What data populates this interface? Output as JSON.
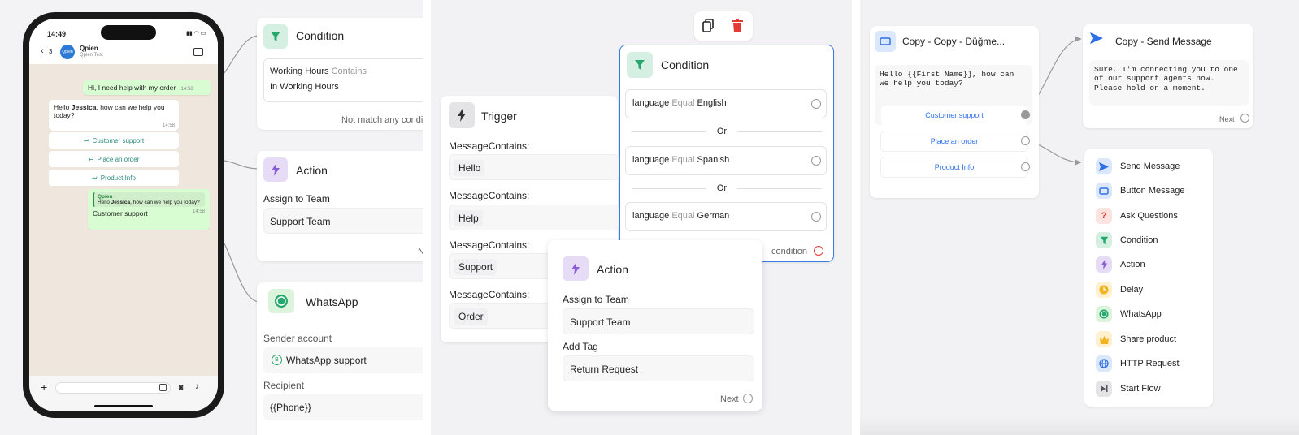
{
  "phone": {
    "time": "14:49",
    "back_count": "3",
    "contact_avatar": "Qpien",
    "contact_name": "Qpien",
    "contact_sub": "Qpien Test",
    "messages": {
      "m1": {
        "text": "Hi, I need help with my order",
        "time": "14:58"
      },
      "m2": {
        "pre": "Hello ",
        "bold": "Jessica",
        "post": ", how can we help you today?",
        "time": "14:58"
      },
      "m3": {
        "quote_name": "Qpien",
        "quote_pre": "Hello ",
        "quote_bold": "Jessica",
        "quote_post": ", how can we help you today?",
        "text": "Customer support",
        "time": "14:58"
      }
    },
    "quick_replies": [
      "Customer support",
      "Place an order",
      "Product Info"
    ]
  },
  "panel1": {
    "condition": {
      "title": "Condition",
      "line1_key": "Working Hours",
      "line1_op": "Contains",
      "line2": "In Working Hours",
      "footer": "Not match any condit"
    },
    "action": {
      "title": "Action",
      "label": "Assign to Team",
      "value": "Support Team",
      "footer": "N"
    },
    "whatsapp": {
      "title": "WhatsApp",
      "sender_label": "Sender account",
      "sender_value": "WhatsApp support",
      "recipient_label": "Recipient",
      "recipient_value": "{{Phone}}"
    }
  },
  "panel2": {
    "trigger": {
      "title": "Trigger",
      "items": [
        {
          "label": "MessageContains:",
          "value": "Hello"
        },
        {
          "label": "MessageContains:",
          "value": "Help"
        },
        {
          "label": "MessageContains:",
          "value": "Support"
        },
        {
          "label": "MessageContains:",
          "value": "Order"
        }
      ]
    },
    "condition": {
      "title": "Condition",
      "rows": [
        {
          "key": "language",
          "op": "Equal",
          "val": "English"
        },
        {
          "key": "language",
          "op": "Equal",
          "val": "Spanish"
        },
        {
          "key": "language",
          "op": "Equal",
          "val": "German"
        }
      ],
      "or": "Or",
      "footer": "condition"
    },
    "action": {
      "title": "Action",
      "label1": "Assign to Team",
      "value1": "Support Team",
      "label2": "Add Tag",
      "value2": "Return Request",
      "footer": "Next"
    }
  },
  "panel3": {
    "button_msg": {
      "title": "Copy - Copy - Düğme...",
      "text": "Hello {{First Name}}, how can we help you today?",
      "buttons": [
        "Customer support",
        "Place an order",
        "Product Info"
      ]
    },
    "send_msg": {
      "title": "Copy - Send Message",
      "text": "Sure, I'm connecting you to one of our support agents now. Please hold on a moment.",
      "footer": "Next"
    },
    "menu": [
      {
        "label": "Send Message",
        "icon": "send-icon",
        "color": "#dbe8fb"
      },
      {
        "label": "Button Message",
        "icon": "button-icon",
        "color": "#dbe8fb"
      },
      {
        "label": "Ask Questions",
        "icon": "question-icon",
        "color": "#fbe4e0"
      },
      {
        "label": "Condition",
        "icon": "filter-icon",
        "color": "#d5f0e3"
      },
      {
        "label": "Action",
        "icon": "bolt-icon",
        "color": "#e6dcf5"
      },
      {
        "label": "Delay",
        "icon": "clock-icon",
        "color": "#fdf1cf"
      },
      {
        "label": "WhatsApp",
        "icon": "whatsapp-icon",
        "color": "#dcf4dc"
      },
      {
        "label": "Share product",
        "icon": "crown-icon",
        "color": "#fdf1cf"
      },
      {
        "label": "HTTP Request",
        "icon": "globe-icon",
        "color": "#dbe8fb"
      },
      {
        "label": "Start Flow",
        "icon": "play-icon",
        "color": "#e4e4e6"
      }
    ]
  },
  "colors": {
    "green": "#25a86b",
    "purple": "#8a5cd6",
    "blue": "#2d6fe8",
    "red": "#e53935"
  }
}
